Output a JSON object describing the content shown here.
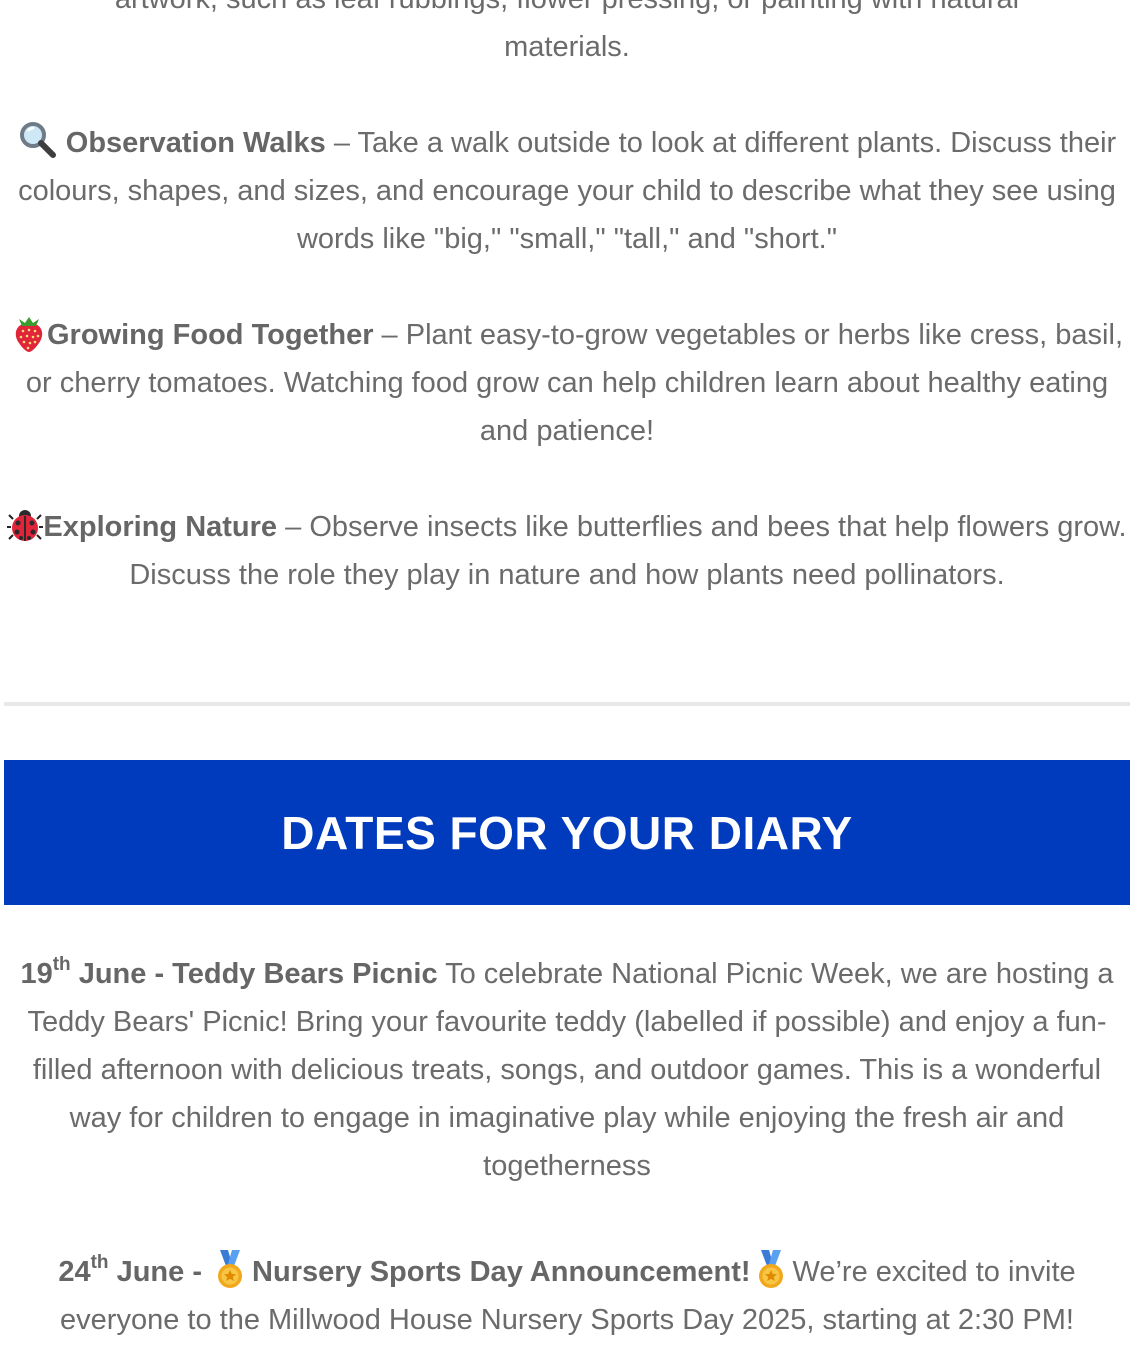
{
  "intro_tail": {
    "line1": "artwork, such as leaf rubbings, flower pressing, or painting with natural",
    "line2": "materials."
  },
  "activities": [
    {
      "icon": "magnifying-glass-icon",
      "title": "Observation Walks",
      "text": " – Take a walk outside to look at different plants. Discuss their colours, shapes, and sizes, and encourage your child to describe what they see using words like \"big,\" \"small,\" \"tall,\" and \"short.\""
    },
    {
      "icon": "strawberry-icon",
      "title": "Growing Food Together",
      "text": " – Plant easy-to-grow vegetables or herbs like cress, basil, or cherry tomatoes. Watching food grow can help children learn about healthy eating and patience!"
    },
    {
      "icon": "ladybug-icon",
      "title": "Exploring Nature",
      "text": " – Observe insects like butterflies and bees that help flowers grow. Discuss the role they play in nature and how plants need pollinators."
    }
  ],
  "diary": {
    "heading": "DATES FOR YOUR DIARY",
    "events": [
      {
        "day": "19",
        "suffix": "th",
        "title": " June - Teddy Bears Picnic",
        "text": " To celebrate National Picnic Week, we are hosting a Teddy Bears' Picnic! Bring your favourite teddy (labelled if possible) and enjoy a fun-filled afternoon with delicious treats, songs, and outdoor games. This is a wonderful way for children to engage in imaginative play while enjoying the fresh air and togetherness"
      },
      {
        "day": "24",
        "suffix": "th",
        "title_a": " June - ",
        "title_b": "Nursery Sports Day Announcement!",
        "text": "We’re excited to invite everyone to the Millwood House Nursery Sports Day 2025, starting at 2:30 PM!",
        "icon": "medal-icon"
      }
    ]
  },
  "colors": {
    "banner": "#003abd",
    "body_text": "#6b6b6b",
    "divider": "#e8e8e8"
  }
}
